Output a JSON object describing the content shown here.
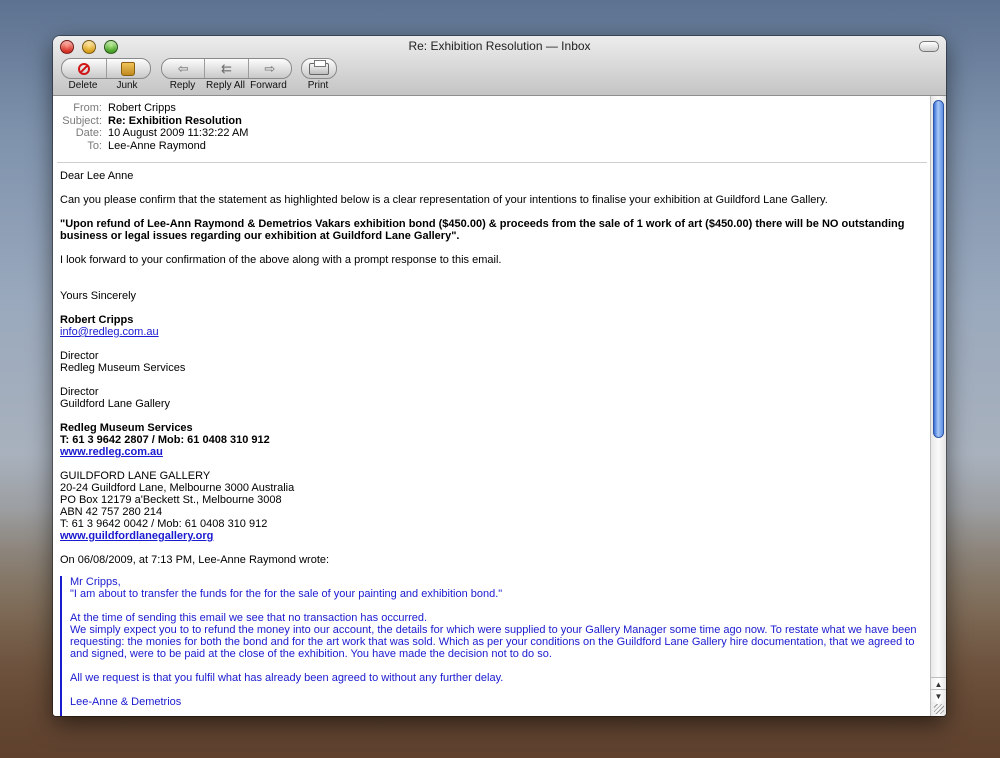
{
  "window": {
    "title": "Re: Exhibition Resolution — Inbox"
  },
  "toolbar": {
    "delete_label": "Delete",
    "junk_label": "Junk",
    "reply_label": "Reply",
    "reply_all_label": "Reply All",
    "forward_label": "Forward",
    "print_label": "Print"
  },
  "headers": {
    "from_key": "From:",
    "from": "Robert Cripps",
    "subject_key": "Subject:",
    "subject": "Re: Exhibition Resolution",
    "date_key": "Date:",
    "date": "10 August 2009 11:32:22 AM",
    "to_key": "To:",
    "to": "Lee-Anne Raymond"
  },
  "message": {
    "greeting": "Dear Lee Anne",
    "p1": "Can you please confirm that the statement as highlighted below is a clear representation of your intentions to finalise your exhibition at Guildford Lane Gallery.",
    "highlight": "\"Upon refund of Lee-Ann Raymond & Demetrios Vakars exhibition bond ($450.00) & proceeds from the sale of 1 work of art ($450.00) there will be NO outstanding business or legal issues regarding our exhibition at Guildford Lane Gallery\".",
    "p2": "I look forward to your confirmation of the above along with a prompt response to this email.",
    "signoff": "Yours Sincerely",
    "sig_name": "Robert Cripps",
    "sig_email": "info@redleg.com.au",
    "role1_title": "Director",
    "role1_org": "Redleg Museum Services",
    "role2_title": "Director",
    "role2_org": "Guildford Lane Gallery",
    "org1_name": "Redleg Museum Services",
    "org1_phone": "T: 61 3 9642 2807 / Mob: 61 0408 310 912",
    "org1_web": "www.redleg.com.au",
    "org2_name": "GUILDFORD LANE GALLERY",
    "org2_addr1": "20-24 Guildford Lane, Melbourne 3000 Australia",
    "org2_addr2": "PO Box 12179 a'Beckett St., Melbourne 3008",
    "org2_abn": "ABN 42 757 280 214",
    "org2_phone": "T: 61 3 9642 0042 / Mob: 61 0408 310 912",
    "org2_web": "www.guildfordlanegallery.org",
    "quote_intro": "On 06/08/2009, at 7:13 PM, Lee-Anne Raymond wrote:"
  },
  "quote": {
    "salutation": "Mr Cripps,",
    "line1": "\"I am about to transfer the funds for the for the sale of your painting and exhibition bond.\"",
    "line2": "At the time of sending this email we see that no transaction has occurred.",
    "line3": "We simply expect you to to refund the money into our account, the details for which were supplied to your Gallery Manager some time ago now. To restate what we have been requesting: the monies for both the bond and for the art work that was sold. Which as per your conditions on the Guildford Lane Gallery hire documentation, that we agreed to and signed, were to be paid at the close of the exhibition. You have made the decision not to do so.",
    "line4": "All we request is that you fulfil what has already been agreed to without any further delay.",
    "signature": "Lee-Anne & Demetrios"
  }
}
